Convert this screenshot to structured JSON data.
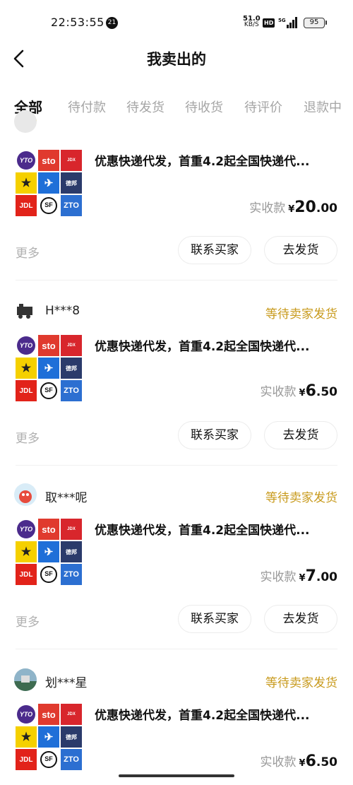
{
  "status_bar": {
    "time": "22:53:55",
    "notification_count": "21",
    "net_speed_value": "51.0",
    "net_speed_unit": "KB/S",
    "hd_label": "HD",
    "network": "5G",
    "battery": "95"
  },
  "header": {
    "title": "我卖出的"
  },
  "tabs": [
    "全部",
    "待付款",
    "待发货",
    "待收货",
    "待评价",
    "退款中"
  ],
  "active_tab": 0,
  "orders": [
    {
      "buyer": "",
      "status": "",
      "title": "优惠快递代发，首重4.2起全国快递代...",
      "price_label": "实收款",
      "currency": "¥",
      "price_int": "20",
      "price_dec": ".00",
      "more": "更多",
      "contact_btn": "联系买家",
      "ship_btn": "去发货"
    },
    {
      "buyer": "H***8",
      "status": "等待卖家发货",
      "title": "优惠快递代发，首重4.2起全国快递代...",
      "price_label": "实收款",
      "currency": "¥",
      "price_int": "6",
      "price_dec": ".50",
      "more": "更多",
      "contact_btn": "联系买家",
      "ship_btn": "去发货"
    },
    {
      "buyer": "取***呢",
      "status": "等待卖家发货",
      "title": "优惠快递代发，首重4.2起全国快递代...",
      "price_label": "实收款",
      "currency": "¥",
      "price_int": "7",
      "price_dec": ".00",
      "more": "更多",
      "contact_btn": "联系买家",
      "ship_btn": "去发货"
    },
    {
      "buyer": "划***星",
      "status": "等待卖家发货",
      "title": "优惠快递代发，首重4.2起全国快递代...",
      "price_label": "实收款",
      "currency": "¥",
      "price_int": "6",
      "price_dec": ".50"
    }
  ],
  "product_logos": {
    "yto": "YTO",
    "sto": "sto",
    "jdx": "JDX",
    "jdl": "JDL",
    "sf": "SF",
    "zto": "ZTO",
    "debang": "德邦"
  },
  "colors": {
    "status": "#c89a1c",
    "tab_indicator": "#ffe033",
    "inactive_tab": "#a5a5a5"
  }
}
